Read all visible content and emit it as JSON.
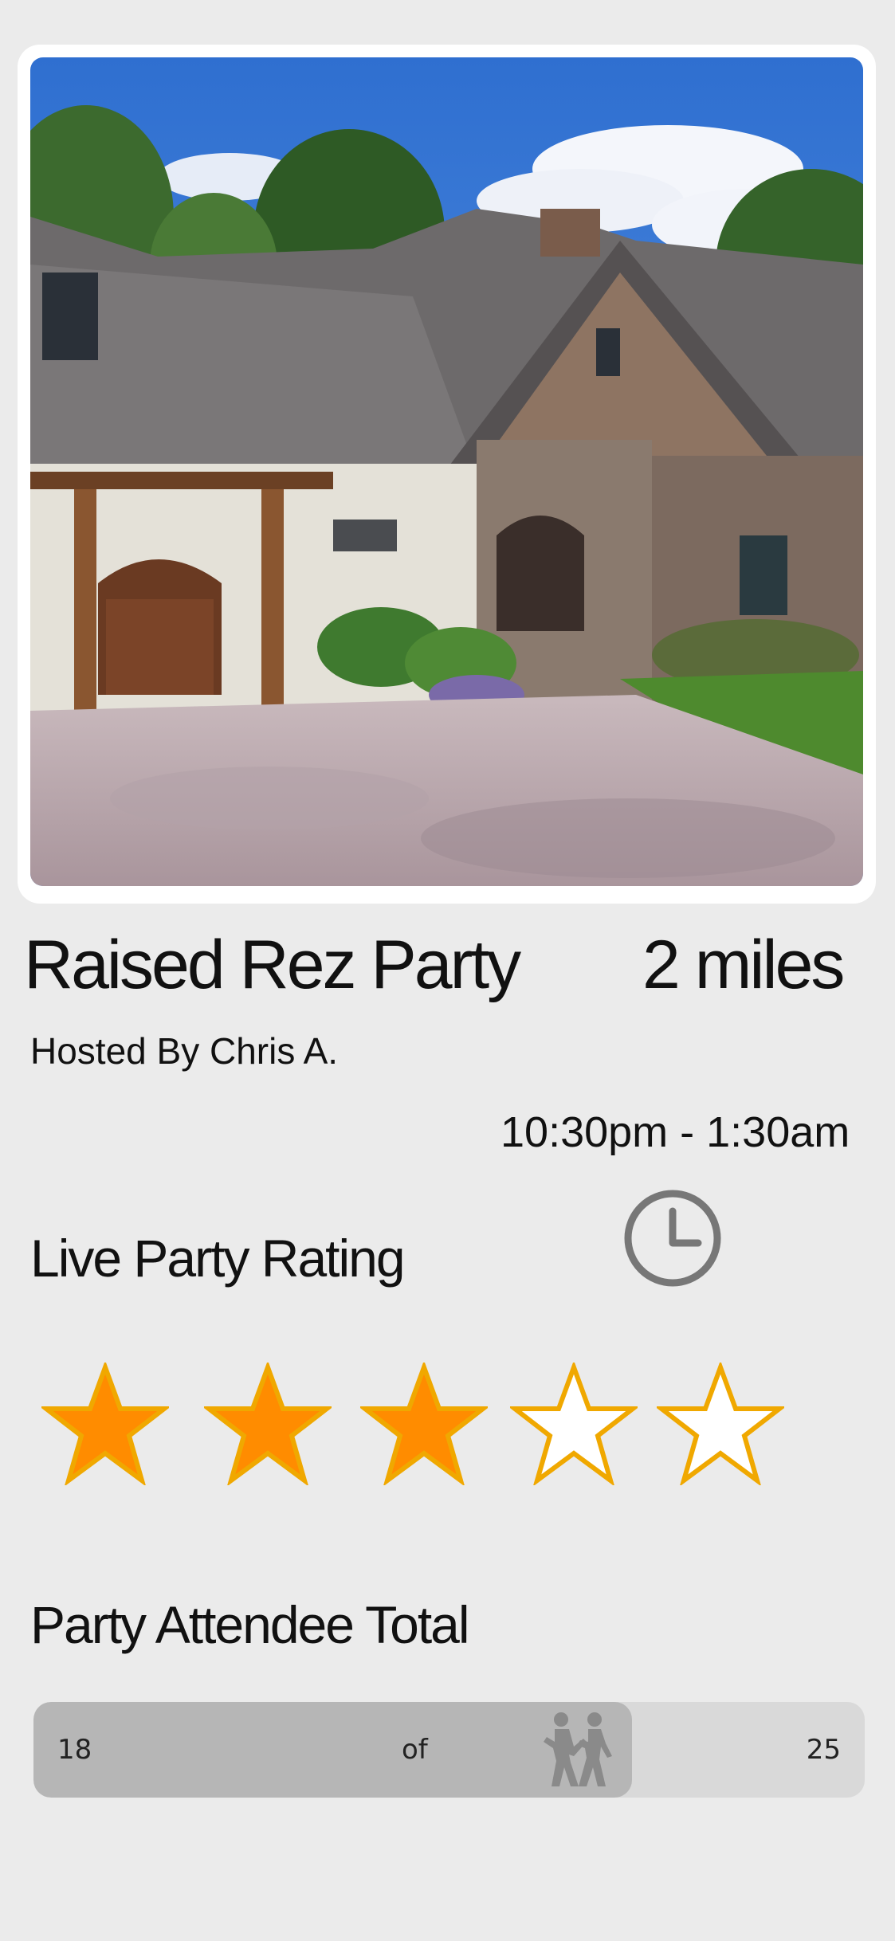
{
  "event": {
    "title": "Raised Rez Party",
    "distance": "2 miles",
    "host": "Hosted By Chris A.",
    "time": "10:30pm - 1:30am",
    "photo_description_icon": "house-photo"
  },
  "rating": {
    "label": "Live Party Rating",
    "value": 3,
    "max": 5,
    "filled_color": "#ff8c00",
    "outline_color": "#f0a800"
  },
  "attendees": {
    "label": "Party Attendee Total",
    "count": "18",
    "separator": "of",
    "total": "25",
    "fill_fraction": 0.72,
    "icon": "dancers-icon"
  },
  "icons": {
    "clock": "clock-icon",
    "star": "star-icon"
  }
}
